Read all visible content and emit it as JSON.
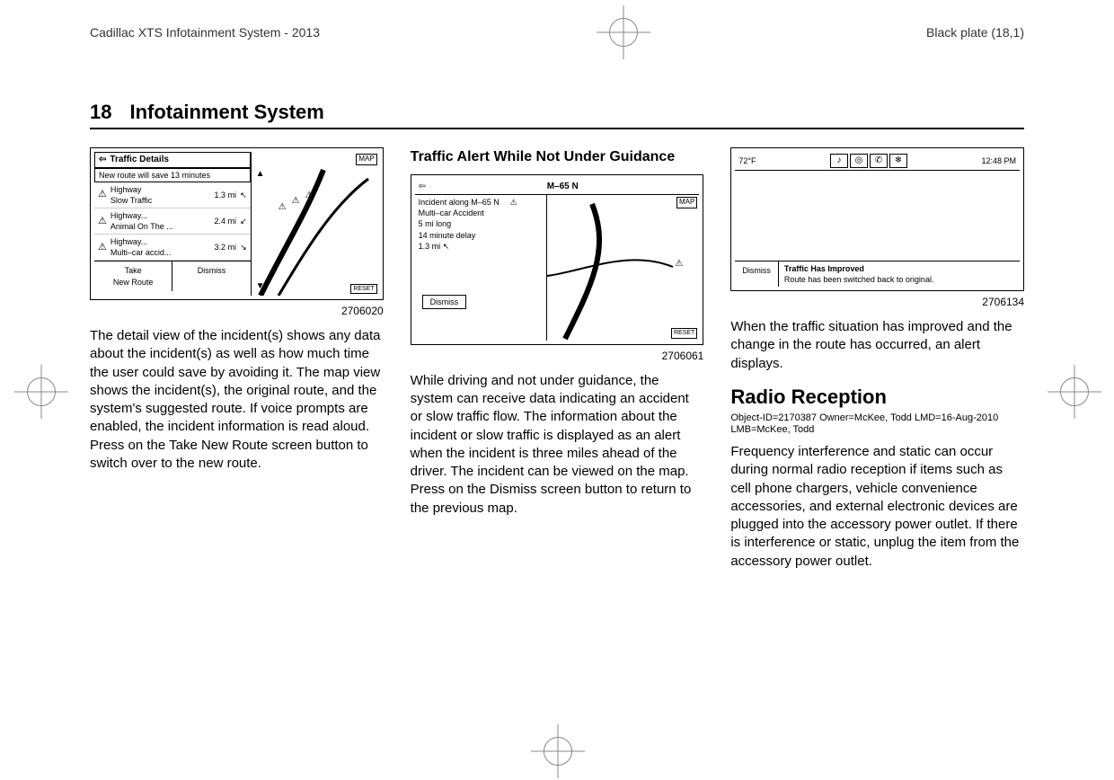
{
  "header": {
    "left": "Cadillac XTS Infotainment System - 2013",
    "right": "Black plate (18,1)"
  },
  "page": {
    "number": "18",
    "title": "Infotainment System"
  },
  "col1": {
    "fig": {
      "title": "Traffic Details",
      "subtitle": "New route will save 13 minutes",
      "rows": [
        {
          "line1": "Highway",
          "line2": "Slow Traffic",
          "dist": "1.3 mi"
        },
        {
          "line1": "Highway...",
          "line2": "Animal On The ...",
          "dist": "2.4 mi"
        },
        {
          "line1": "Highway...",
          "line2": "Multi–car accid...",
          "dist": "3.2 mi"
        }
      ],
      "btn_take": "Take\nNew Route",
      "btn_dismiss": "Dismiss",
      "map_label": "MAP",
      "caption": "2706020"
    },
    "body": "The detail view of the incident(s) shows any data about the incident(s) as well as how much time the user could save by avoiding it. The map view shows the incident(s), the original route, and the system's suggested route. If voice prompts are enabled, the incident information is read aloud. Press on the Take New Route screen button to switch over to the new route."
  },
  "col2": {
    "subhead": "Traffic Alert While Not Under Guidance",
    "fig": {
      "road": "M–65 N",
      "lines": [
        "Incident along M–65 N",
        "Multi–car Accident",
        "5 mi long",
        "14 minute delay",
        "1.3 mi"
      ],
      "btn_dismiss": "Dismiss",
      "map_label": "MAP",
      "caption": "2706061"
    },
    "body": "While driving and not under guidance, the system can receive data indicating an accident or slow traffic flow. The information about the incident or slow traffic is displayed as an alert when the incident is three miles ahead of the driver. The incident can be viewed on the map. Press on the Dismiss screen button to return to the previous map."
  },
  "col3": {
    "fig": {
      "temp": "72°F",
      "time": "12:48 PM",
      "btn_dismiss": "Dismiss",
      "message_title": "Traffic Has Improved",
      "message_body": "Route has been switched back to original.",
      "caption": "2706134"
    },
    "body1": "When the traffic situation has improved and the change in the route has occurred, an alert displays.",
    "h2": "Radio Reception",
    "meta": "Object-ID=2170387 Owner=McKee, Todd LMD=16-Aug-2010 LMB=McKee, Todd",
    "body2": "Frequency interference and static can occur during normal radio reception if items such as cell phone chargers, vehicle convenience accessories, and external electronic devices are plugged into the accessory power outlet. If there is interference or static, unplug the item from the accessory power outlet."
  }
}
